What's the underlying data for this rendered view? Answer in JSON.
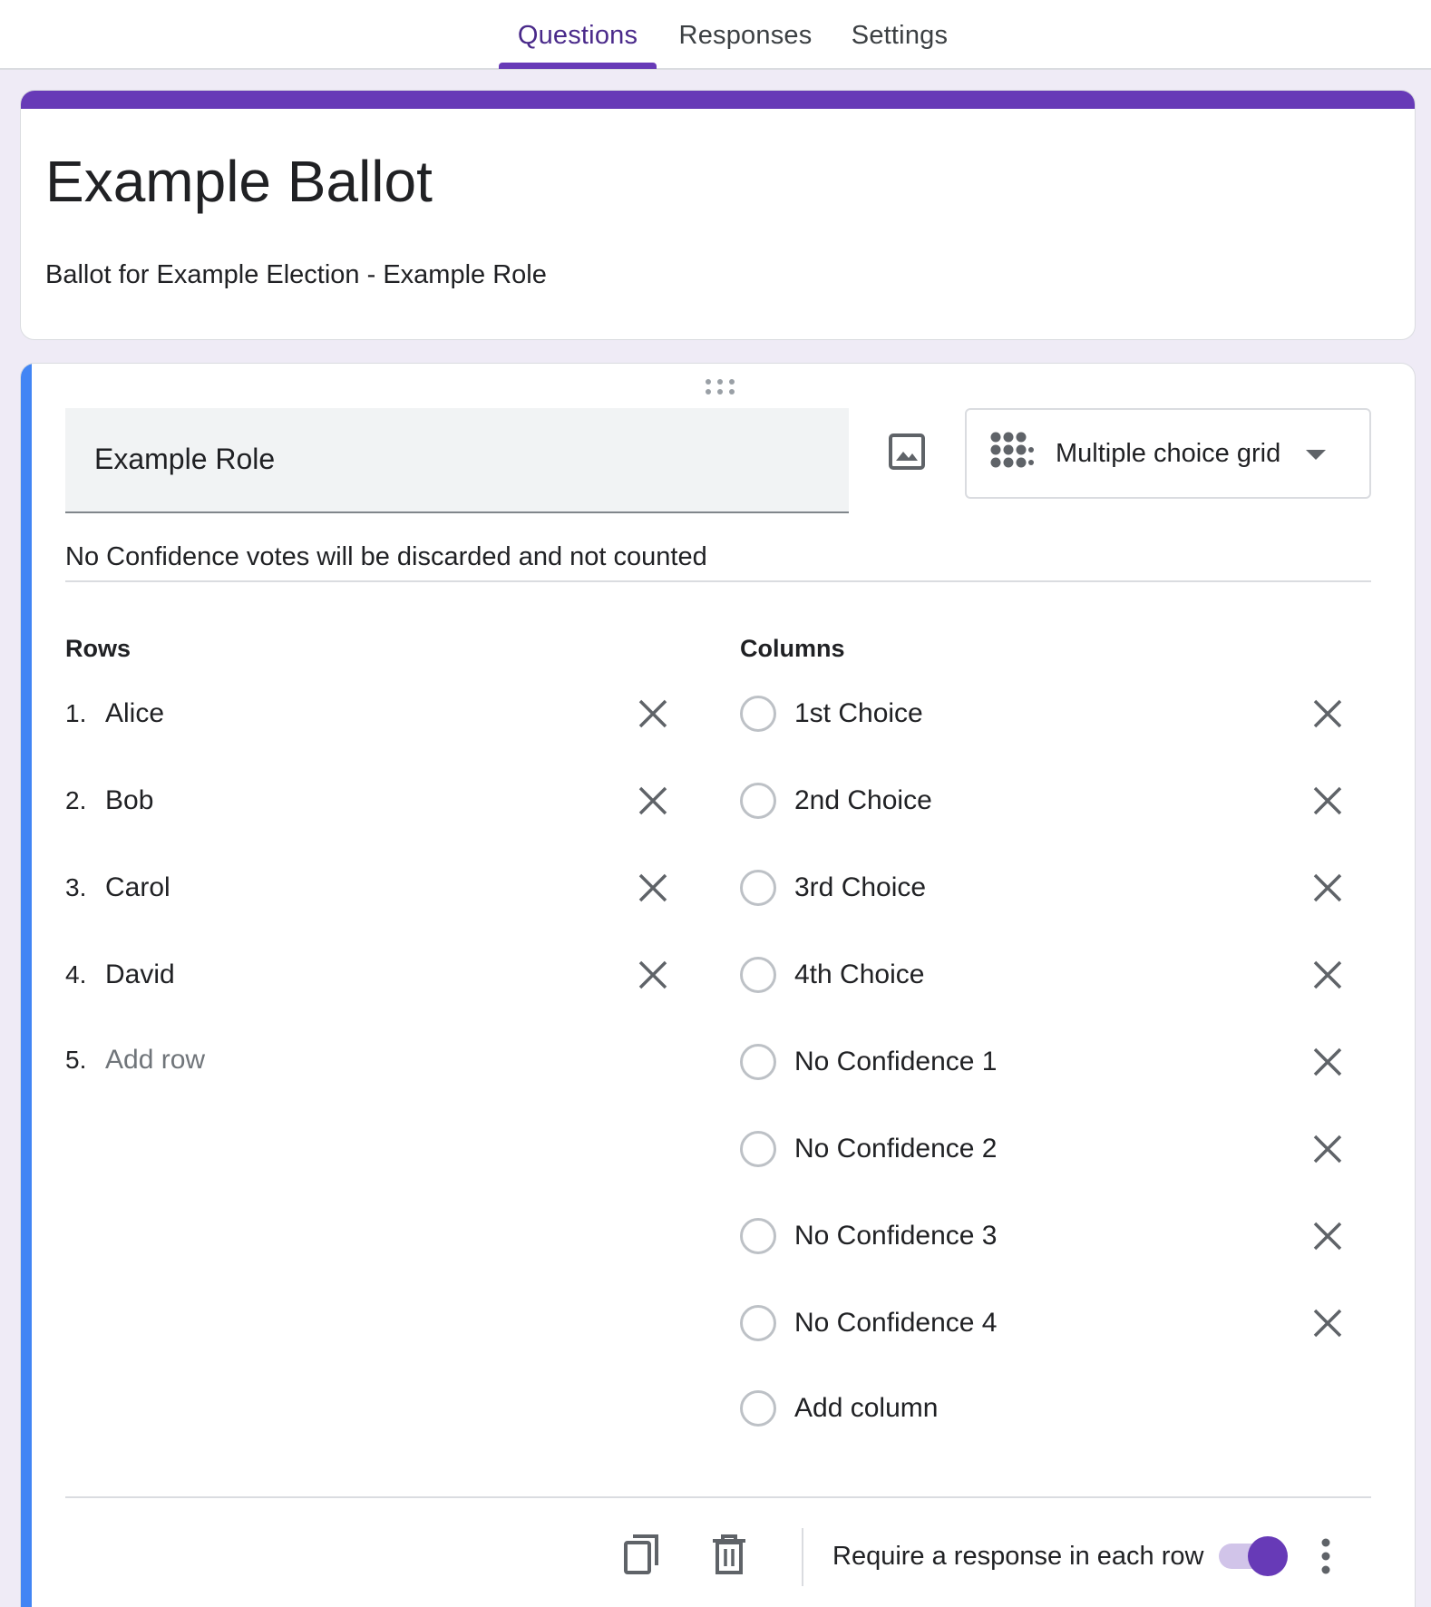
{
  "tabs": [
    {
      "label": "Questions",
      "active": true
    },
    {
      "label": "Responses",
      "active": false
    },
    {
      "label": "Settings",
      "active": false
    }
  ],
  "accent_color": "#673ab7",
  "question_accent_color": "#4285f4",
  "form": {
    "title": "Example Ballot",
    "description": "Ballot for Example Election - Example Role"
  },
  "question": {
    "title": "Example Role",
    "type": "Multiple choice grid",
    "type_icon": "grid-dots-icon",
    "description": "No Confidence votes will be discarded and not counted",
    "rows_label": "Rows",
    "columns_label": "Columns",
    "rows": [
      {
        "number": "1.",
        "label": "Alice"
      },
      {
        "number": "2.",
        "label": "Bob"
      },
      {
        "number": "3.",
        "label": "Carol"
      },
      {
        "number": "4.",
        "label": "David"
      }
    ],
    "add_row": {
      "number": "5.",
      "label": "Add row"
    },
    "columns": [
      "1st Choice",
      "2nd Choice",
      "3rd Choice",
      "4th Choice",
      "No Confidence 1",
      "No Confidence 2",
      "No Confidence 3",
      "No Confidence 4"
    ],
    "add_column": "Add column",
    "require_label": "Require a response in each row",
    "require_enabled": true
  }
}
